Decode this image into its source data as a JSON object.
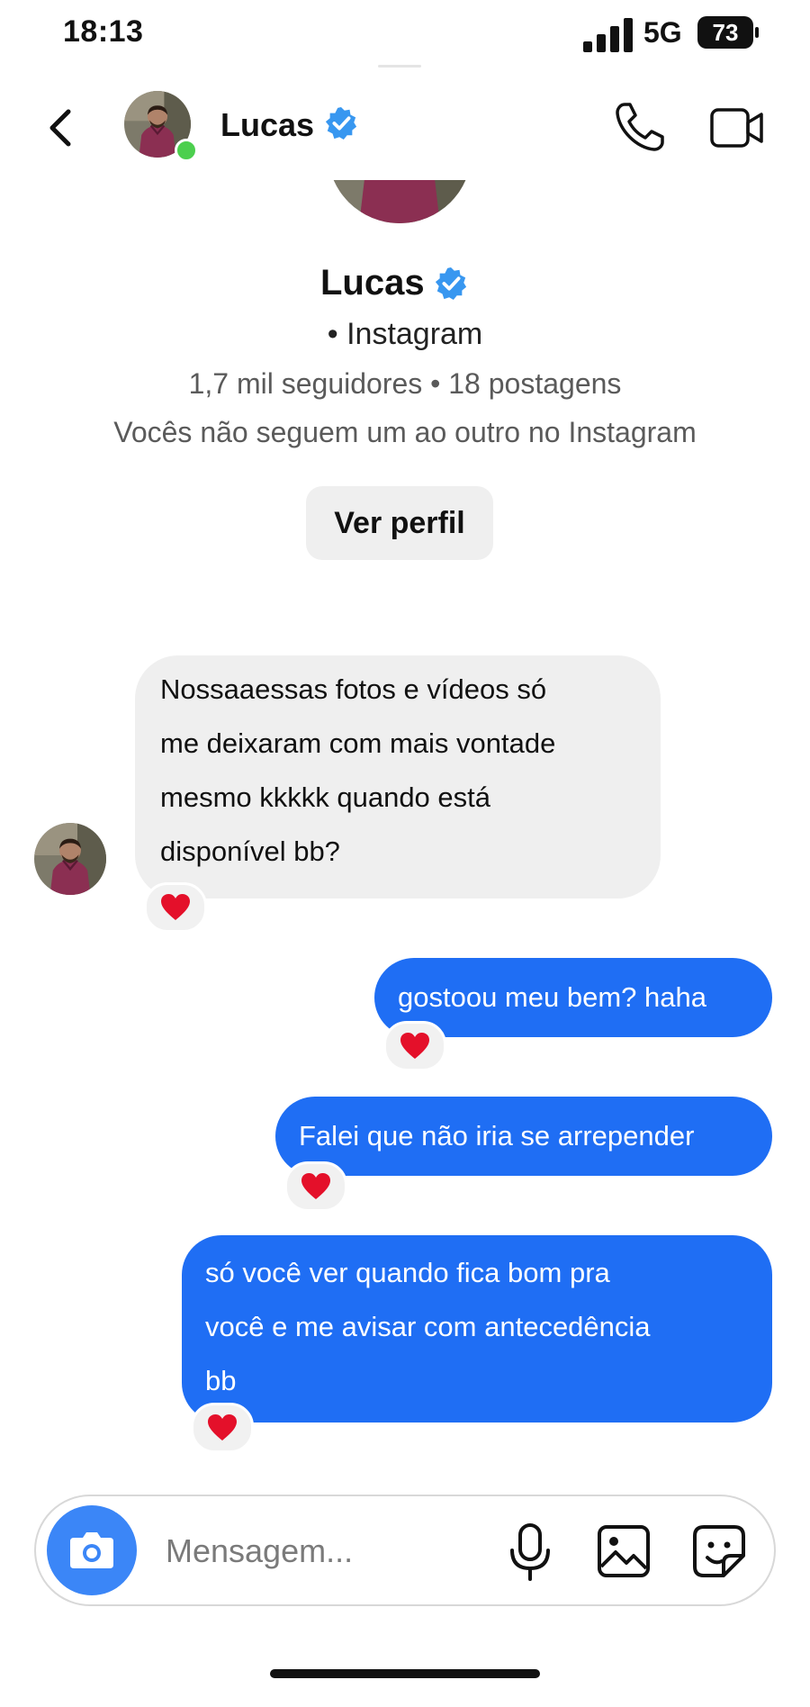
{
  "status_bar": {
    "time": "18:13",
    "network": "5G",
    "battery": "73"
  },
  "header": {
    "contact_name": "Lucas"
  },
  "profile": {
    "name": "Lucas",
    "platform": "• Instagram",
    "stats": "1,7 mil seguidores • 18 postagens",
    "follow_status": "Vocês não seguem um ao outro no Instagram",
    "view_profile_label": "Ver perfil"
  },
  "messages": [
    {
      "direction": "received",
      "lines": [
        "Nossaaessas fotos e vídeos só",
        "me deixaram com mais vontade",
        "mesmo kkkkk quando está",
        "disponível bb?"
      ],
      "reaction": "heart"
    },
    {
      "direction": "sent",
      "lines": [
        "gostoou meu bem? haha"
      ],
      "reaction": "heart"
    },
    {
      "direction": "sent",
      "lines": [
        "Falei que não iria se arrepender"
      ],
      "reaction": "heart"
    },
    {
      "direction": "sent",
      "lines": [
        "só você ver quando fica bom pra",
        "você e me avisar com antecedência",
        "bb"
      ],
      "reaction": "heart"
    }
  ],
  "composer": {
    "placeholder": "Mensagem..."
  },
  "colors": {
    "sent_bubble": "#1f6ef4",
    "received_bubble": "#efefef",
    "verified": "#3897f0",
    "online": "#4ccf4e",
    "reaction_heart": "#e4102a"
  }
}
